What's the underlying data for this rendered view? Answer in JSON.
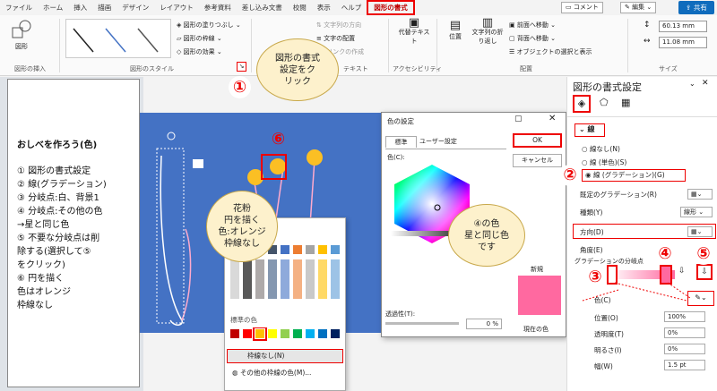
{
  "ribbon": {
    "tabs": [
      "ファイル",
      "ホーム",
      "挿入",
      "描画",
      "デザイン",
      "レイアウト",
      "参考資料",
      "差し込み文書",
      "校閲",
      "表示",
      "ヘルプ",
      "図形の書式"
    ],
    "comment_label": "コメント",
    "edit_label": "編集",
    "share_label": "共有",
    "shape_fill": "図形の塗りつぶし",
    "shape_outline": "図形の枠線",
    "shape_effect": "図形の効果",
    "text_direction": "文字列の方向",
    "text_align": "文字の配置",
    "link_create": "リンクの作成",
    "alt_text": "代替テキスト",
    "position": "位置",
    "wrap": "文字列の折り返し",
    "bring_forward": "前面へ移動",
    "send_backward": "背面へ移動",
    "selection_pane": "オブジェクトの選択と表示",
    "height": "60.13 mm",
    "width": "11.08 mm",
    "insert_shape_label": "図形",
    "groups": {
      "insert": "図形の挿入",
      "styles": "図形のスタイル",
      "text": "テキスト",
      "accessibility": "アクセシビリティ",
      "arrange": "配置",
      "size": "サイズ"
    }
  },
  "note": {
    "title": "おしべを作ろう(色)",
    "lines": [
      "①  図形の書式設定",
      "②  線(グラデーション)",
      "③  分岐点:白、背景1",
      "④  分岐点:その他の色",
      "     →星と同じ色",
      "⑤  不要な分岐点は削",
      "     除する(選択して⑤",
      "     をクリック)",
      "⑥  円を描く",
      "     色はオレンジ",
      "     枠線なし"
    ]
  },
  "bubbles": {
    "b1": [
      "図形の書式",
      "設定をク",
      "リック"
    ],
    "b6": [
      "花粉",
      "円を描く",
      "色:オレンジ",
      "枠線なし"
    ],
    "b4": [
      "④の色",
      "星と同じ色",
      "です"
    ]
  },
  "nums": {
    "n1": "①",
    "n2": "②",
    "n3": "③",
    "n4": "④",
    "n5": "⑤",
    "n6": "⑥"
  },
  "dialog": {
    "title": "色の設定",
    "tab_std": "標準",
    "tab_user": "ユーザー設定",
    "ok": "OK",
    "cancel": "キャンセル",
    "color_label": "色(C):",
    "transparency": "透過性(T):",
    "trans_value": "0 %",
    "new_label": "新規",
    "current_label": "現在の色",
    "new_color": "#ff69a0"
  },
  "color_menu": {
    "std_label": "標準の色",
    "no_line": "枠線なし(N)",
    "more": "その他の枠線の色(M)..."
  },
  "pane": {
    "title": "図形の書式設定",
    "line_section": "線",
    "no_line": "線なし(N)",
    "solid": "線 (単色)(S)",
    "gradient": "線 (グラデーション)(G)",
    "preset": "既定のグラデーション(R)",
    "type": "種類(Y)",
    "type_value": "線形",
    "direction": "方向(D)",
    "angle": "角度(E)",
    "stops": "グラデーションの分岐点",
    "color": "色(C)",
    "position": "位置(O)",
    "position_value": "100%",
    "transparency": "透明度(T)",
    "trans_value": "0%",
    "brightness": "明るさ(I)",
    "bright_value": "0%",
    "width": "幅(W)",
    "width_value": "1.5 pt"
  }
}
